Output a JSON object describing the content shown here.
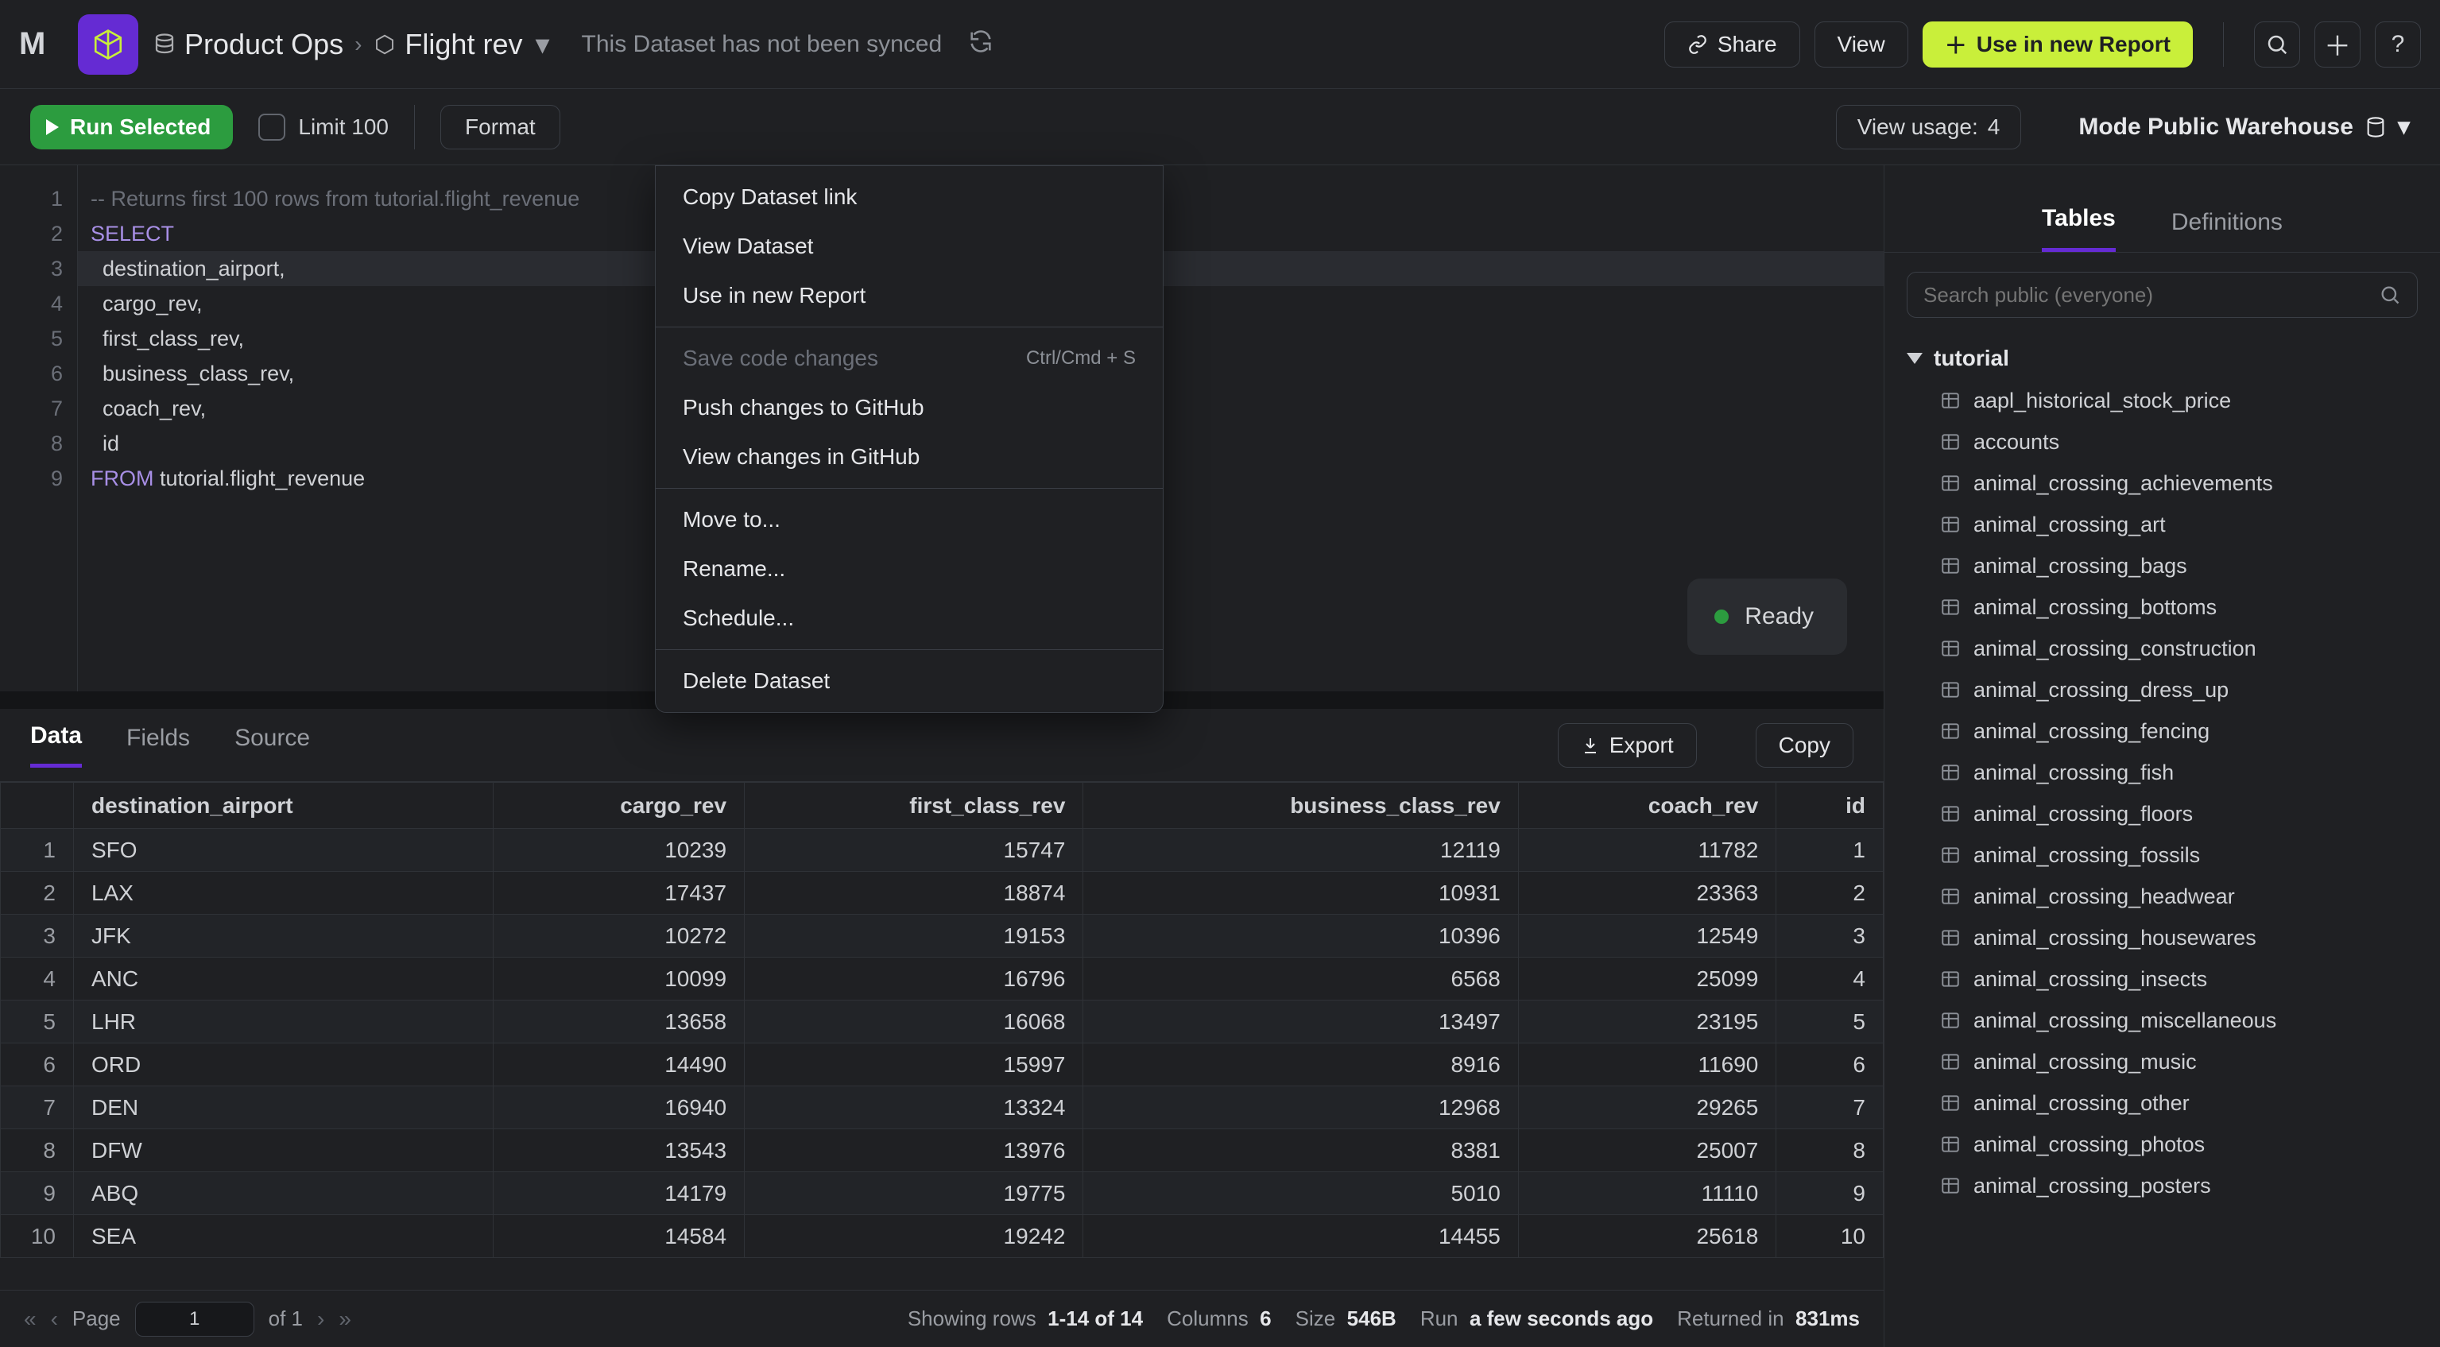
{
  "topbar": {
    "project": "Product Ops",
    "dataset": "Flight rev",
    "sync_text": "This Dataset has not been synced",
    "share": "Share",
    "view": "View",
    "use_in_new_report": "Use in new Report"
  },
  "actionbar": {
    "run": "Run Selected",
    "limit": "Limit 100",
    "format": "Format",
    "view_usage_label": "View usage:",
    "view_usage_count": "4",
    "warehouse": "Mode Public Warehouse"
  },
  "editor": {
    "lines": [
      {
        "n": "1",
        "c": "-- Returns first 100 rows from tutorial.flight_revenue",
        "cls": "tok-c"
      },
      {
        "n": "2",
        "c": "SELECT",
        "cls": "tok-k"
      },
      {
        "n": "3",
        "c": "  destination_airport,",
        "cls": "tok-w"
      },
      {
        "n": "4",
        "c": "  cargo_rev,",
        "cls": "tok-w"
      },
      {
        "n": "5",
        "c": "  first_class_rev,",
        "cls": "tok-w"
      },
      {
        "n": "6",
        "c": "  business_class_rev,",
        "cls": "tok-w"
      },
      {
        "n": "7",
        "c": "  coach_rev,",
        "cls": "tok-w"
      },
      {
        "n": "8",
        "c": "  id",
        "cls": "tok-w"
      },
      {
        "n": "9",
        "c": "FROM tutorial.flight_revenue",
        "cls": "tok-w"
      }
    ],
    "from_kw": "FROM",
    "ready": "Ready"
  },
  "context_menu": {
    "items": [
      {
        "label": "Copy Dataset link",
        "type": "item"
      },
      {
        "label": "View Dataset",
        "type": "item"
      },
      {
        "label": "Use in new Report",
        "type": "item"
      },
      {
        "type": "sep"
      },
      {
        "label": "Save code changes",
        "type": "item",
        "disabled": true,
        "kbd": "Ctrl/Cmd + S"
      },
      {
        "label": "Push changes to GitHub",
        "type": "item"
      },
      {
        "label": "View changes in GitHub",
        "type": "item"
      },
      {
        "type": "sep"
      },
      {
        "label": "Move to...",
        "type": "item"
      },
      {
        "label": "Rename...",
        "type": "item"
      },
      {
        "label": "Schedule...",
        "type": "item"
      },
      {
        "type": "sep"
      },
      {
        "label": "Delete Dataset",
        "type": "item"
      }
    ]
  },
  "lower_tabs": {
    "data": "Data",
    "fields": "Fields",
    "source": "Source",
    "export": "Export",
    "copy": "Copy"
  },
  "grid": {
    "columns": [
      "destination_airport",
      "cargo_rev",
      "first_class_rev",
      "business_class_rev",
      "coach_rev",
      "id"
    ],
    "rows": [
      [
        "SFO",
        "10239",
        "15747",
        "12119",
        "11782",
        "1"
      ],
      [
        "LAX",
        "17437",
        "18874",
        "10931",
        "23363",
        "2"
      ],
      [
        "JFK",
        "10272",
        "19153",
        "10396",
        "12549",
        "3"
      ],
      [
        "ANC",
        "10099",
        "16796",
        "6568",
        "25099",
        "4"
      ],
      [
        "LHR",
        "13658",
        "16068",
        "13497",
        "23195",
        "5"
      ],
      [
        "ORD",
        "14490",
        "15997",
        "8916",
        "11690",
        "6"
      ],
      [
        "DEN",
        "16940",
        "13324",
        "12968",
        "29265",
        "7"
      ],
      [
        "DFW",
        "13543",
        "13976",
        "8381",
        "25007",
        "8"
      ],
      [
        "ABQ",
        "14179",
        "19775",
        "5010",
        "11110",
        "9"
      ],
      [
        "SEA",
        "14584",
        "19242",
        "14455",
        "25618",
        "10"
      ]
    ]
  },
  "footer": {
    "first": "«",
    "prev": "‹",
    "next": "›",
    "last": "»",
    "page_label": "Page",
    "page_value": "1",
    "of_label": "of 1",
    "showing_label": "Showing rows",
    "showing_value": "1-14 of 14",
    "columns_label": "Columns",
    "columns_value": "6",
    "size_label": "Size",
    "size_value": "546B",
    "run_label": "Run",
    "run_value": "a few seconds ago",
    "returned_label": "Returned in",
    "returned_value": "831ms"
  },
  "side": {
    "tab_tables": "Tables",
    "tab_definitions": "Definitions",
    "search_placeholder": "Search public (everyone)",
    "group": "tutorial",
    "tables": [
      "aapl_historical_stock_price",
      "accounts",
      "animal_crossing_achievements",
      "animal_crossing_art",
      "animal_crossing_bags",
      "animal_crossing_bottoms",
      "animal_crossing_construction",
      "animal_crossing_dress_up",
      "animal_crossing_fencing",
      "animal_crossing_fish",
      "animal_crossing_floors",
      "animal_crossing_fossils",
      "animal_crossing_headwear",
      "animal_crossing_housewares",
      "animal_crossing_insects",
      "animal_crossing_miscellaneous",
      "animal_crossing_music",
      "animal_crossing_other",
      "animal_crossing_photos",
      "animal_crossing_posters"
    ]
  }
}
